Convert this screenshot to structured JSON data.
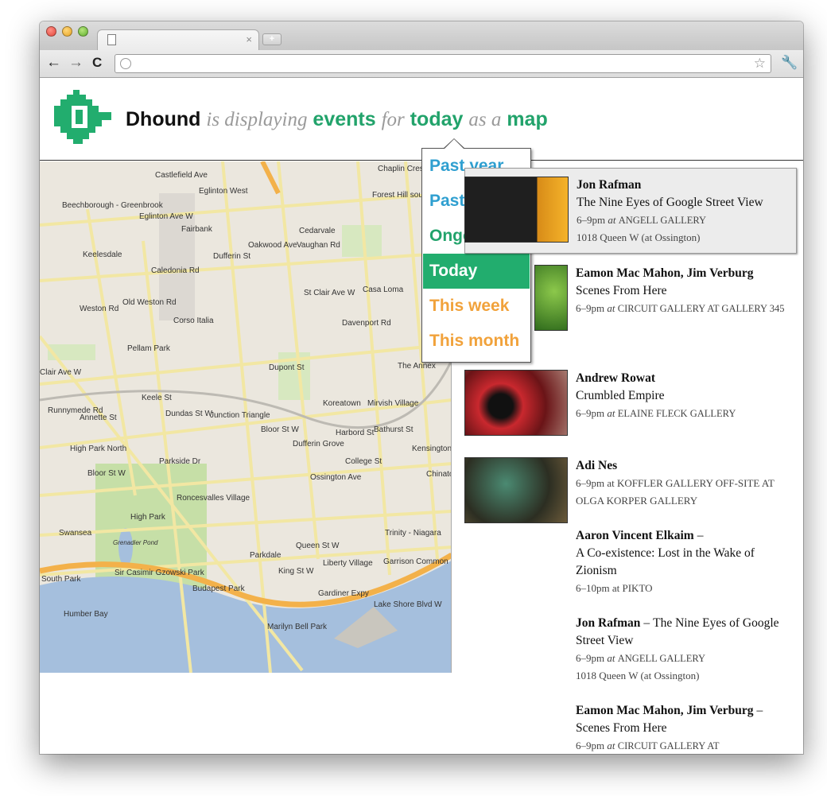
{
  "browser": {
    "tab_close": "×",
    "new_tab": "+",
    "back": "←",
    "forward": "→",
    "reload": "C",
    "star": "☆",
    "wrench": "🔧"
  },
  "header": {
    "brand": "Dhound",
    "w1": "is displaying",
    "what": "events",
    "w2": "for",
    "when": "today",
    "w3": "as a",
    "view": "map"
  },
  "dropdown": {
    "items": [
      {
        "label": "Past year"
      },
      {
        "label": "Past month"
      },
      {
        "label": "Ongoing"
      },
      {
        "label": "Today",
        "selected": true
      },
      {
        "label": "This week"
      },
      {
        "label": "This month"
      }
    ]
  },
  "map_labels": [
    "Castlefield Ave",
    "Eglinton West",
    "Forest Hill south",
    "Chaplin Cres",
    "Beechborough - Greenbrook",
    "Eglinton Ave W",
    "Fairbank",
    "Cedarvale",
    "Vaughan Rd",
    "Keelesdale",
    "Caledonia Rd",
    "Dufferin St",
    "Oakwood Ave",
    "St Clair Ave W",
    "Casa Loma",
    "Weston Rd",
    "Old Weston Rd",
    "Corso Italia",
    "Davenport Rd",
    "Pellam Park",
    "Dupont St",
    "The Annex",
    "Clair Ave W",
    "Runnymede Rd",
    "Annette St",
    "Keele St",
    "Dundas St W",
    "Junction Triangle",
    "Bloor St W",
    "Koreatown",
    "Mirvish Village",
    "Harbord St",
    "High Park North",
    "Dufferin Grove",
    "College St",
    "Kensington Market",
    "Chinatown",
    "Roncesvalles Village",
    "High Park",
    "Swansea",
    "Grenadier Pond",
    "Parkdale",
    "Queen St W",
    "Trinity - Niagara",
    "Liberty Village",
    "Garrison Common",
    "Sir Casimir Gzowski Park",
    "Budapest Park",
    "Humber Bay",
    "King St W",
    "Gardiner Expy",
    "Lake Shore Blvd W",
    "Marilyn Bell Park",
    "South Park",
    "Ossington Ave",
    "Bathurst St",
    "Parkside Dr",
    "Bloor St W"
  ],
  "events": [
    {
      "artist": "Jon Rafman",
      "title": "The Nine Eyes of Google Street View",
      "time": "6–9pm",
      "at": "at",
      "venue": "ANGELL GALLERY",
      "address": "1018 Queen W (at Ossington)"
    },
    {
      "artist": "Eamon Mac Mahon, Jim Verburg",
      "title": "Scenes From Here",
      "time": "6–9pm",
      "at": "at",
      "venue": "CIRCUIT GALLERY AT GALLERY 345"
    },
    {
      "artist": "Andrew Rowat",
      "title": "Crumbled Empire",
      "time": "6–9pm",
      "at": "at",
      "venue": "ELAINE FLECK GALLERY"
    },
    {
      "artist": "Adi Nes",
      "meta": "6–9pm at KOFFLER GALLERY OFF-SITE AT OLGA KORPER GALLERY"
    },
    {
      "artist": "Aaron Vincent Elkaim",
      "dash": "–",
      "title": "A Co-existence: Lost in the Wake of Zionism",
      "meta": "6–10pm at PIKTO"
    },
    {
      "artist": "Jon Rafman",
      "dash": "–",
      "title": "The Nine Eyes of Google Street View",
      "time": "6–9pm",
      "at": "at",
      "venue": "ANGELL GALLERY",
      "address": "1018 Queen W (at Ossington)"
    },
    {
      "artist": "Eamon Mac Mahon, Jim Verburg",
      "dash": "–",
      "title": "Scenes From Here",
      "time": "6–9pm",
      "at": "at",
      "venue": "CIRCUIT GALLERY AT"
    }
  ],
  "colors": {
    "accent_green": "#22a36b",
    "link_blue": "#2f9fd0",
    "link_orange": "#f1a23b"
  }
}
